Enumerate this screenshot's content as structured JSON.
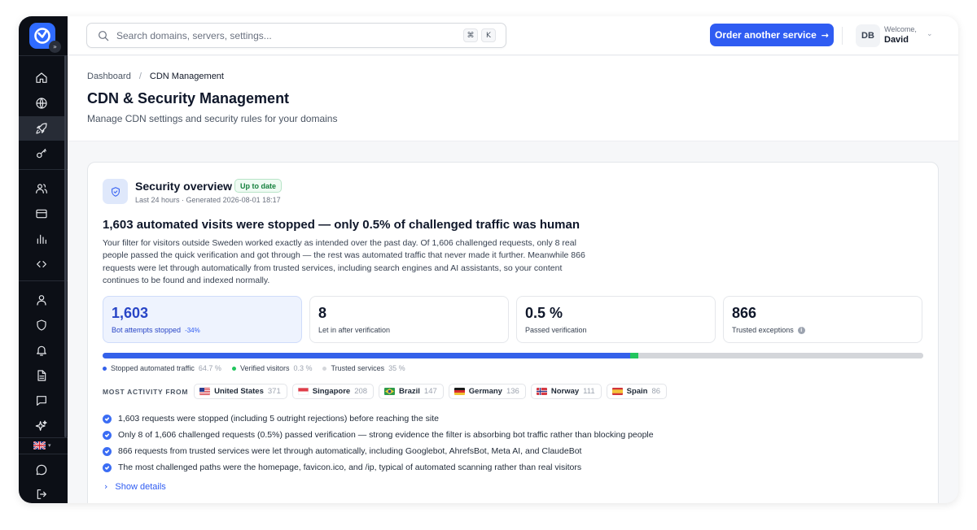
{
  "app": {
    "logo_icon": "logo-icon",
    "expand_icon": "chevrons-right-icon",
    "sidebar": {
      "items": [
        {
          "name": "home",
          "icon": "home-icon",
          "active": false
        },
        {
          "name": "domains",
          "icon": "globe-icon",
          "active": false
        },
        {
          "name": "cdn",
          "icon": "rocket-icon",
          "active": true
        },
        {
          "name": "keys",
          "icon": "key-icon",
          "active": false
        },
        {
          "name": "users",
          "icon": "users-icon",
          "active": false
        },
        {
          "name": "billing",
          "icon": "credit-card-icon",
          "active": false
        },
        {
          "name": "analytics",
          "icon": "bar-chart-icon",
          "active": false
        },
        {
          "name": "developer",
          "icon": "code-icon",
          "active": false
        },
        {
          "name": "account",
          "icon": "user-icon",
          "active": false
        },
        {
          "name": "security",
          "icon": "shield-icon",
          "active": false
        },
        {
          "name": "notifications",
          "icon": "bell-icon",
          "active": false
        },
        {
          "name": "documents",
          "icon": "file-icon",
          "active": false
        },
        {
          "name": "messages",
          "icon": "message-square-icon",
          "active": false
        },
        {
          "name": "ai",
          "icon": "sparkles-icon",
          "active": false
        }
      ],
      "language_flag": "uk-flag-icon",
      "bottom": [
        {
          "name": "support",
          "icon": "chat-bubble-icon"
        },
        {
          "name": "logout",
          "icon": "logout-icon"
        }
      ]
    }
  },
  "topbar": {
    "search_placeholder": "Search domains, servers, settings...",
    "shortcut_key1": "⌘",
    "shortcut_key2": "K",
    "order_button": "Order another service",
    "avatar_initials": "DB",
    "welcome": "Welcome,",
    "username": "David"
  },
  "header": {
    "breadcrumb_root": "Dashboard",
    "breadcrumb_sep": "/",
    "breadcrumb_current": "CDN Management",
    "title": "CDN & Security Management",
    "subtitle": "Manage CDN settings and security rules for your domains"
  },
  "overview": {
    "title": "Security overview",
    "badge": "Up to date",
    "meta": "Last 24 hours · Generated 2026-08-01 18:17",
    "headline": "1,603 automated visits were stopped — only 0.5% of challenged traffic was human",
    "description": "Your filter for visitors outside Sweden worked exactly as intended over the past day. Of 1,606 challenged requests, only 8 real people passed the quick verification and got through — the rest was automated traffic that never made it further. Meanwhile 866 requests were let through automatically from trusted services, including search engines and AI assistants, so your content continues to be found and indexed normally.",
    "stats": [
      {
        "value": "1,603",
        "label": "Bot attempts stopped",
        "delta": "-34%"
      },
      {
        "value": "8",
        "label": "Let in after verification"
      },
      {
        "value": "0.5 %",
        "label": "Passed verification"
      },
      {
        "value": "866",
        "label": "Trusted exceptions",
        "info": "i"
      }
    ],
    "distribution": [
      {
        "label": "Stopped automated traffic",
        "pct_text": "64.7 %",
        "pct": 64.7,
        "color": "#3461ea"
      },
      {
        "label": "Verified visitors",
        "pct_text": "0.3 %",
        "pct": 0.3,
        "color": "#22c55e"
      },
      {
        "label": "Trusted services",
        "pct_text": "35 %",
        "pct": 35,
        "color": "#d4d6da"
      }
    ],
    "activity_label": "MOST ACTIVITY FROM",
    "countries": [
      {
        "name": "United States",
        "count": "371",
        "flag": "us-flag-icon"
      },
      {
        "name": "Singapore",
        "count": "208",
        "flag": "sg-flag-icon"
      },
      {
        "name": "Brazil",
        "count": "147",
        "flag": "br-flag-icon"
      },
      {
        "name": "Germany",
        "count": "136",
        "flag": "de-flag-icon"
      },
      {
        "name": "Norway",
        "count": "111",
        "flag": "no-flag-icon"
      },
      {
        "name": "Spain",
        "count": "86",
        "flag": "es-flag-icon"
      }
    ],
    "bullets": [
      "1,603 requests were stopped (including 5 outright rejections) before reaching the site",
      "Only 8 of 1,606 challenged requests (0.5%) passed verification — strong evidence the filter is absorbing bot traffic rather than blocking people",
      "866 requests from trusted services were let through automatically, including Googlebot, AhrefsBot, Meta AI, and ClaudeBot",
      "The most challenged paths were the homepage, favicon.ico, and /ip, typical of automated scanning rather than real visitors"
    ],
    "show_details": "Show details"
  }
}
